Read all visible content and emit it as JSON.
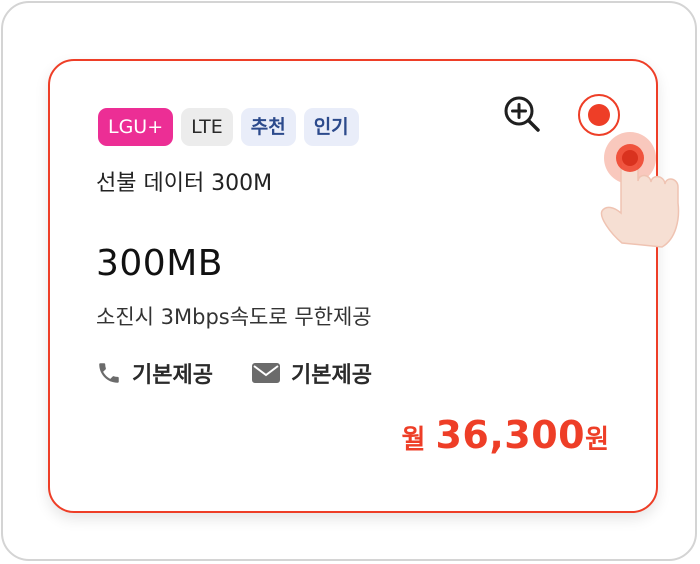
{
  "plan": {
    "tags": [
      {
        "label": "LGU+",
        "style": "carrier"
      },
      {
        "label": "LTE",
        "style": "network"
      },
      {
        "label": "추천",
        "style": "blue"
      },
      {
        "label": "인기",
        "style": "blue"
      }
    ],
    "name": "선불 데이터 300M",
    "data_amount": "300MB",
    "data_description": "소진시 3Mbps속도로 무한제공",
    "features": [
      {
        "icon": "phone-icon",
        "label": "기본제공"
      },
      {
        "icon": "mail-icon",
        "label": "기본제공"
      }
    ],
    "price": {
      "prefix": "월",
      "value": "36,300",
      "suffix": "원"
    },
    "actions": {
      "zoom_icon": "zoom-in-icon",
      "select_icon": "radio-selected-icon"
    },
    "selected": true
  },
  "colors": {
    "accent": "#ee3e27",
    "carrier_tag": "#ec2e95",
    "network_tag_bg": "#ececec",
    "blue_tag_bg": "#e9edf9",
    "blue_tag_text": "#2c4a8c"
  }
}
